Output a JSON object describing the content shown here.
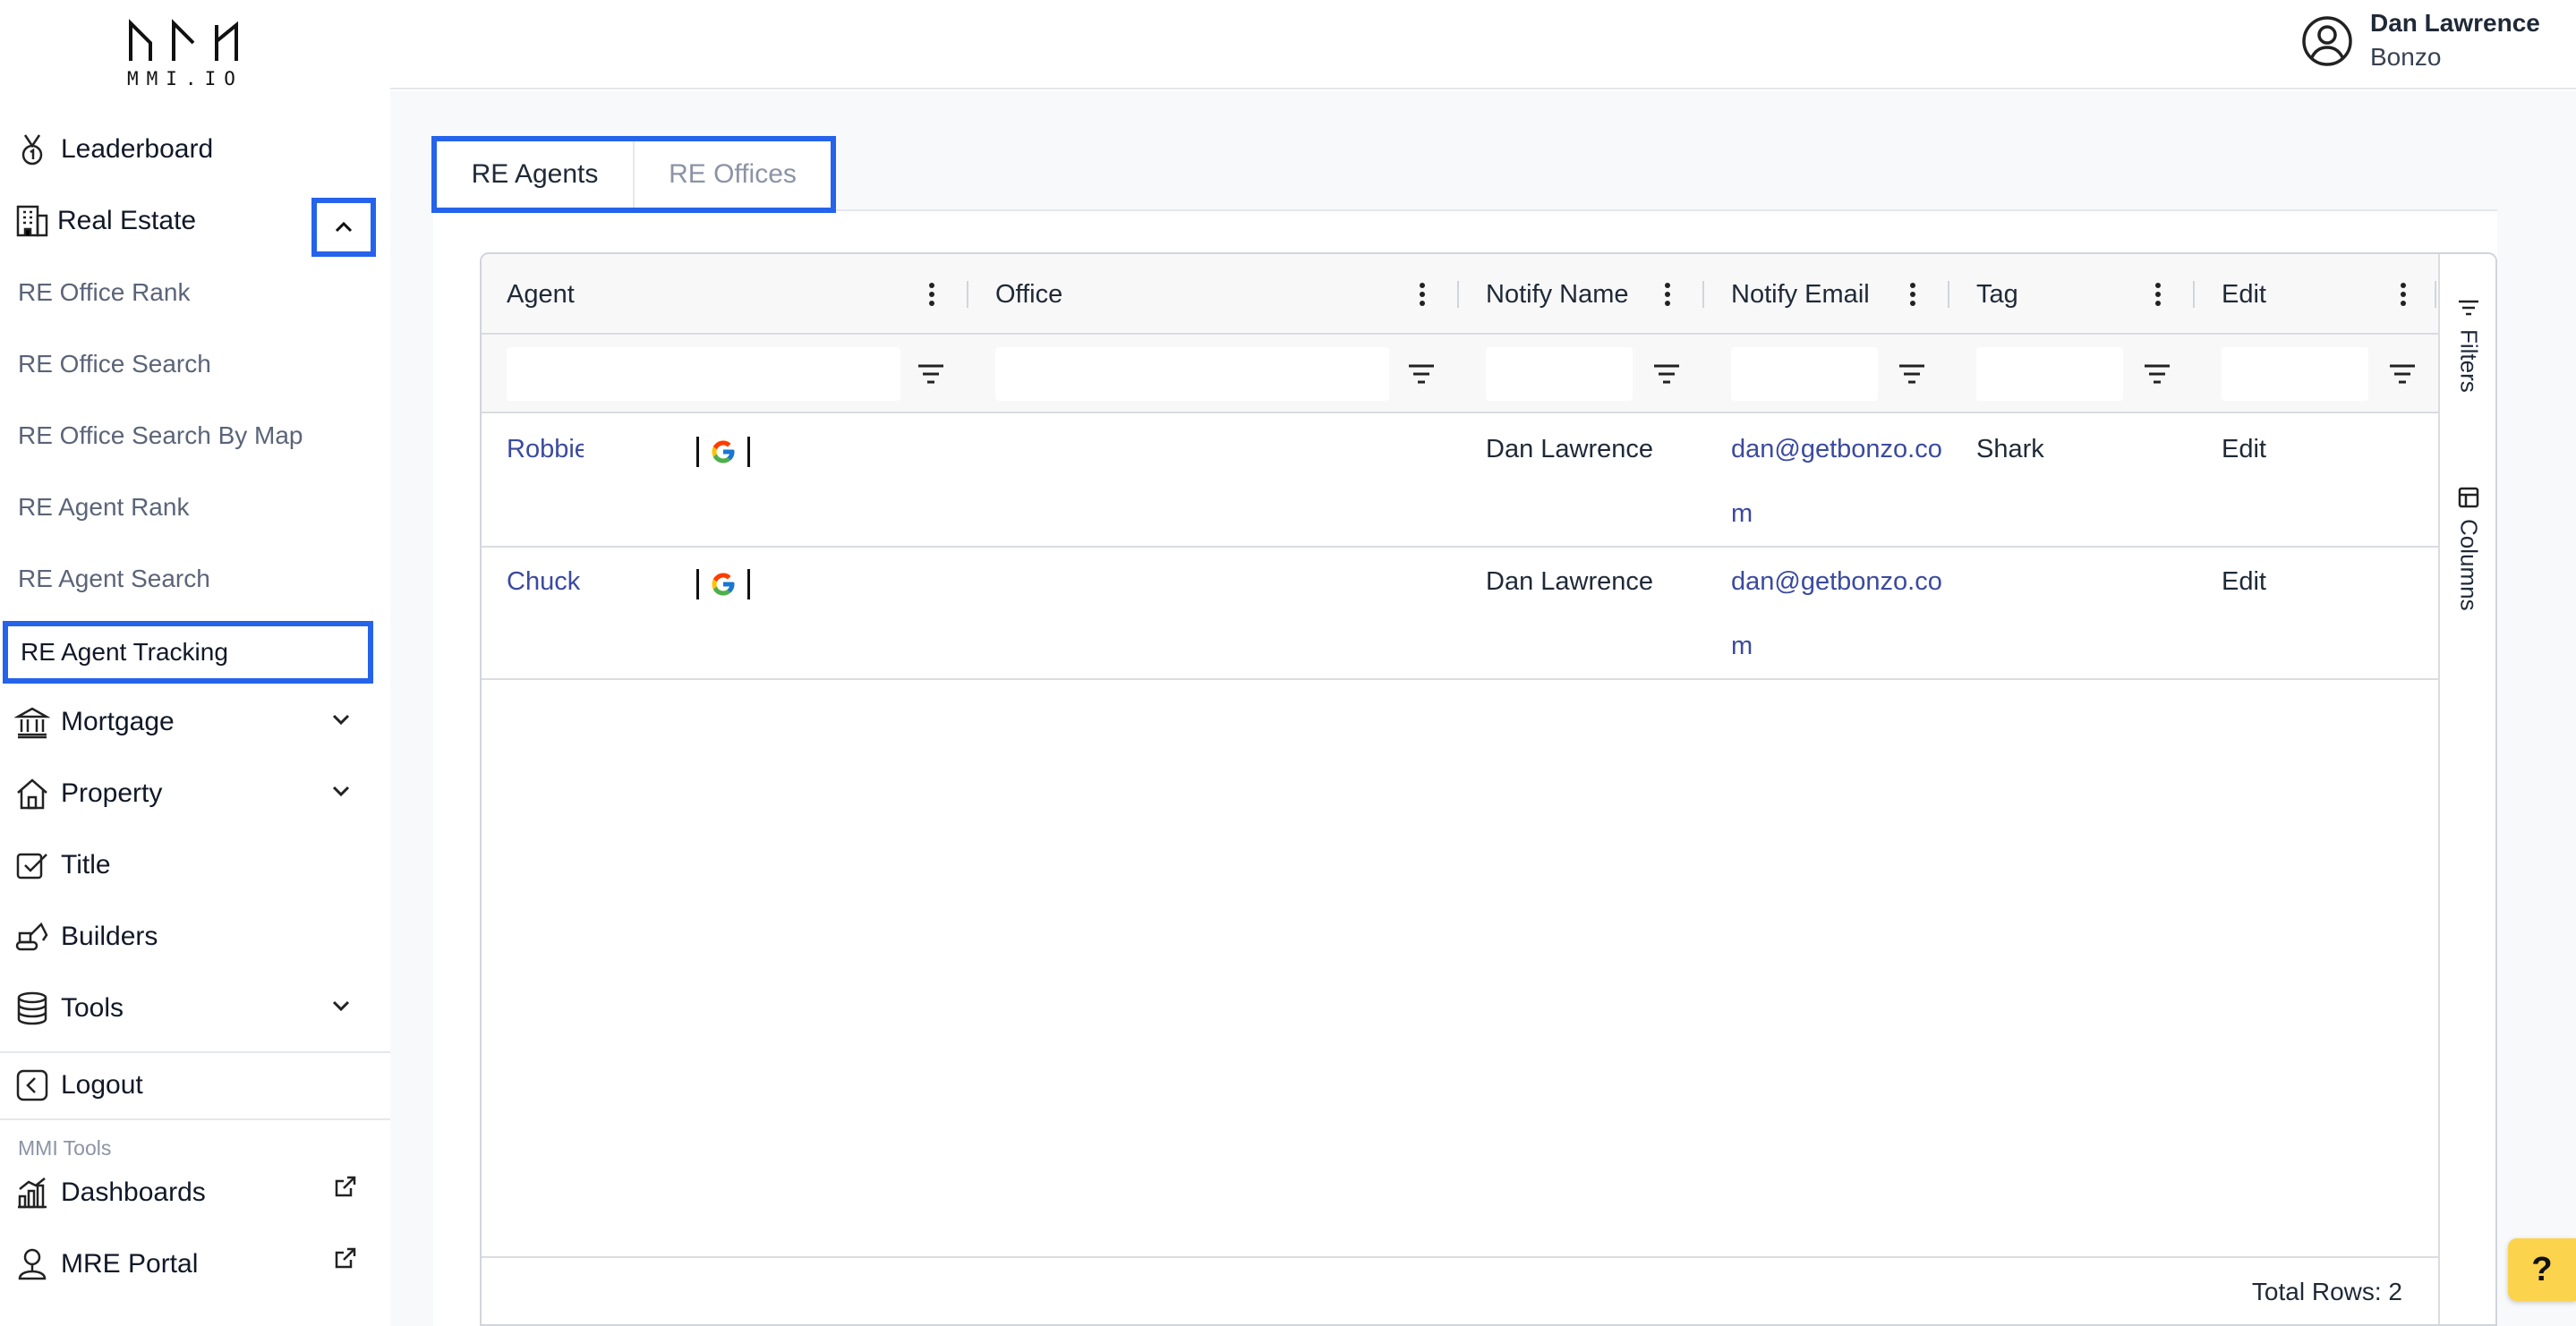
{
  "logo": {
    "text": "MMI.IO"
  },
  "user": {
    "name": "Dan Lawrence",
    "org": "Bonzo"
  },
  "sidebar": {
    "items": [
      {
        "label": "Leaderboard",
        "icon": "medal-icon"
      },
      {
        "label": "Real Estate",
        "icon": "building-icon",
        "expanded": true
      },
      {
        "label": "Mortgage",
        "icon": "bank-icon"
      },
      {
        "label": "Property",
        "icon": "house-icon"
      },
      {
        "label": "Title",
        "icon": "title-check-icon"
      },
      {
        "label": "Builders",
        "icon": "excavator-icon"
      },
      {
        "label": "Tools",
        "icon": "database-icon"
      },
      {
        "label": "Logout",
        "icon": "logout-icon"
      }
    ],
    "real_estate_sub": [
      "RE Office Rank",
      "RE Office Search",
      "RE Office Search By Map",
      "RE Agent Rank",
      "RE Agent Search",
      "RE Agent Tracking"
    ],
    "active_sub": "RE Agent Tracking",
    "tools_section": "MMI Tools",
    "tools_links": [
      {
        "label": "Dashboards",
        "icon": "chart-icon"
      },
      {
        "label": "MRE Portal",
        "icon": "portal-user-icon"
      }
    ]
  },
  "tabs": [
    {
      "label": "RE Agents",
      "active": true
    },
    {
      "label": "RE Offices",
      "active": false
    }
  ],
  "grid": {
    "columns": [
      "Agent",
      "Office",
      "Notify Name",
      "Notify Email",
      "Tag",
      "Edit"
    ],
    "rows": [
      {
        "agent": "Robbie",
        "office": "",
        "notify_name": "Dan Lawrence",
        "notify_email": "dan@getbonzo.com",
        "tag": "Shark",
        "edit": "Edit"
      },
      {
        "agent": "Chuck",
        "office": "",
        "notify_name": "Dan Lawrence",
        "notify_email": "dan@getbonzo.com",
        "tag": "",
        "edit": "Edit"
      }
    ],
    "side_buttons": [
      "Filters",
      "Columns"
    ],
    "footer": "Total Rows: 2"
  },
  "help": "?",
  "colors": {
    "accent_outline": "#2563eb",
    "link": "#3b4a9f",
    "help_bg": "#fcd34d"
  }
}
